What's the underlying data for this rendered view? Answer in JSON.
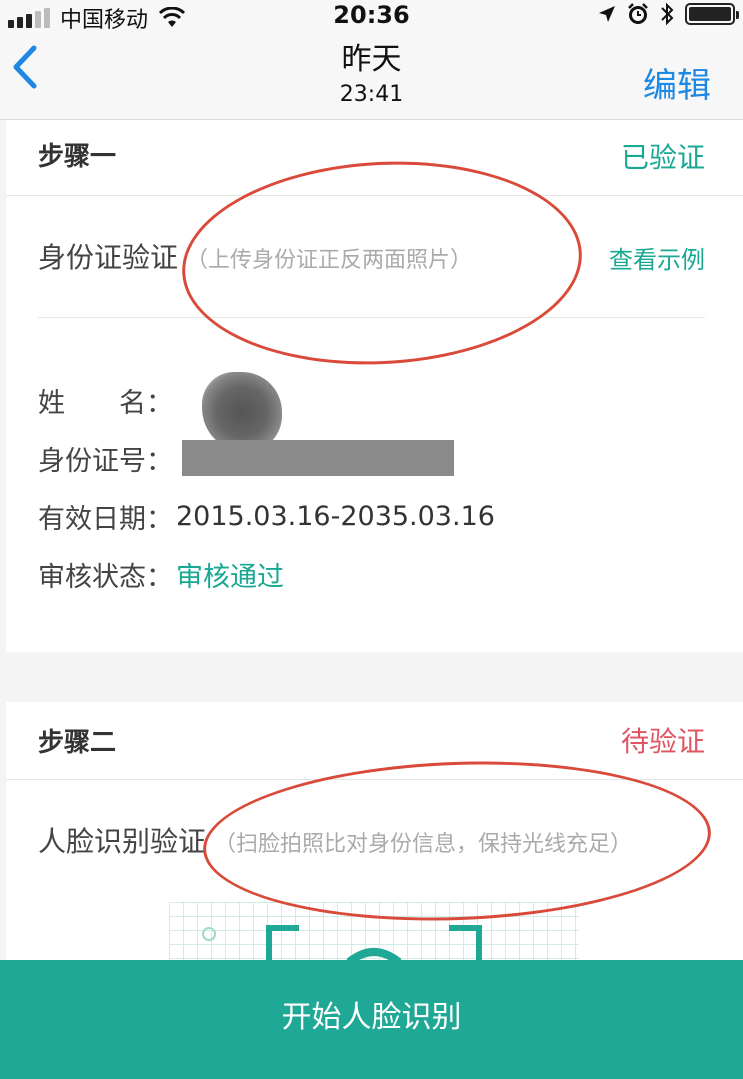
{
  "status_bar": {
    "carrier": "中国移动",
    "time": "20:36"
  },
  "nav": {
    "title": "昨天",
    "subtitle": "23:41",
    "edit_label": "编辑"
  },
  "step1": {
    "title": "步骤一",
    "status": "已验证",
    "verify_label": "身份证验证",
    "verify_hint": "（上传身份证正反两面照片）",
    "example_link": "查看示例",
    "fields": {
      "name_key": "姓　　名：",
      "id_key": "身份证号：",
      "valid_key": "有效日期：",
      "valid_val": "2015.03.16-2035.03.16",
      "review_key": "审核状态：",
      "review_val": "审核通过"
    }
  },
  "step2": {
    "title": "步骤二",
    "status": "待验证",
    "verify_label": "人脸识别验证",
    "verify_hint": "（扫脸拍照比对身份信息，保持光线充足）"
  },
  "start_button": "开始人脸识别",
  "colors": {
    "accent_green": "#1ea895",
    "link_blue": "#1e88e5",
    "pending_red": "#e05563",
    "annotation_red": "#d94a3a"
  }
}
